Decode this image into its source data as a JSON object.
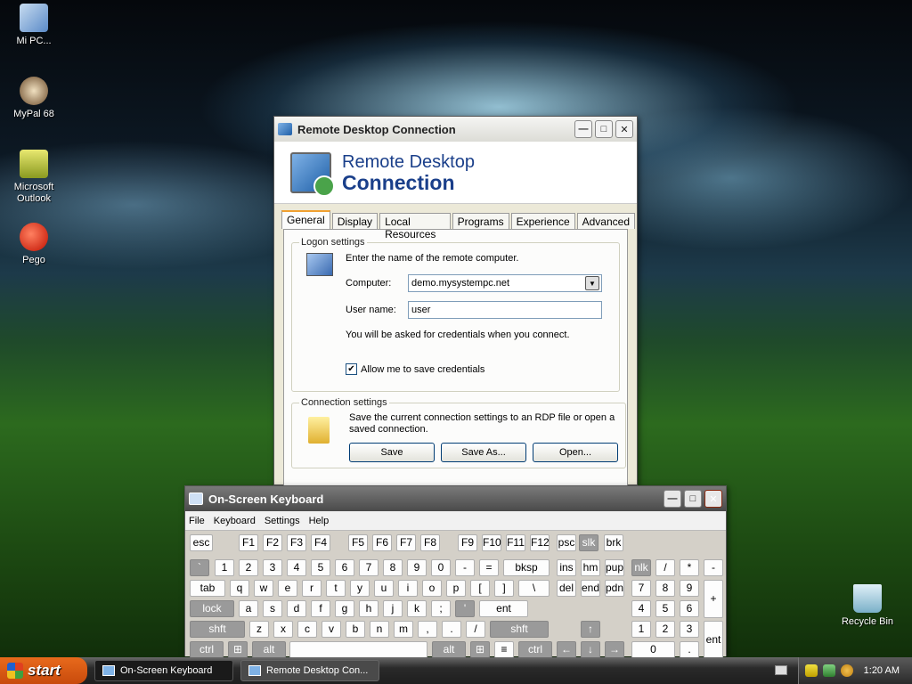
{
  "desktop": {
    "icons": [
      {
        "label": "Mi PC..."
      },
      {
        "label": "MyPal 68"
      },
      {
        "label": "Microsoft Outlook"
      },
      {
        "label": "Pego"
      },
      {
        "label": "Recycle Bin"
      }
    ]
  },
  "rdc": {
    "title": "Remote Desktop Connection",
    "banner_line1": "Remote Desktop",
    "banner_line2": "Connection",
    "tabs": [
      "General",
      "Display",
      "Local Resources",
      "Programs",
      "Experience",
      "Advanced"
    ],
    "selected_tab": "General",
    "logon": {
      "legend": "Logon settings",
      "intro": "Enter the name of the remote computer.",
      "computer_label": "Computer:",
      "computer_value": "demo.mysystempc.net",
      "username_label": "User name:",
      "username_value": "user",
      "note": "You will be asked for credentials when you connect.",
      "allow_save_label": "Allow me to save credentials",
      "allow_save_checked": true
    },
    "connection": {
      "legend": "Connection settings",
      "text": "Save the current connection settings to an RDP file or open a saved connection.",
      "save": "Save",
      "save_as": "Save As...",
      "open": "Open..."
    }
  },
  "osk": {
    "title": "On-Screen Keyboard",
    "menu": [
      "File",
      "Keyboard",
      "Settings",
      "Help"
    ]
  },
  "taskbar": {
    "start": "start",
    "buttons": [
      "On-Screen Keyboard",
      "Remote Desktop Con..."
    ],
    "clock": "1:20 AM"
  }
}
